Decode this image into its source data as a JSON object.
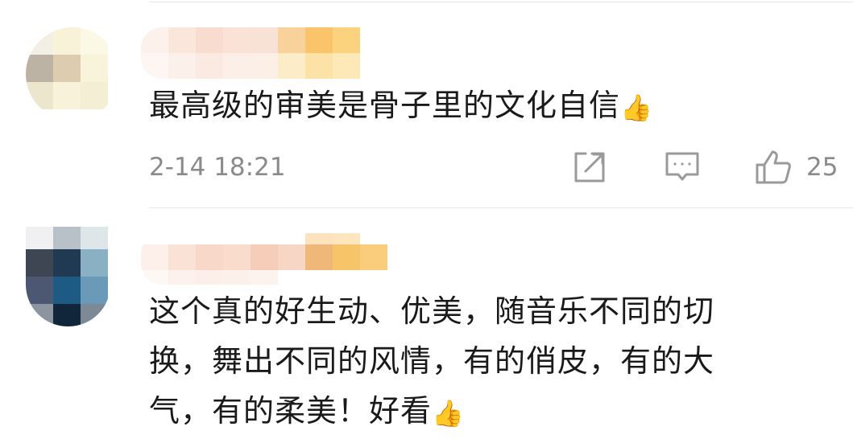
{
  "comments": [
    {
      "text": "最高级的审美是骨子里的文化自信",
      "emoji": "👍",
      "timestamp": "2-14 18:21",
      "likes": "25"
    },
    {
      "lines": [
        "这个真的好生动、优美，随音乐不同的切",
        "换，舞出不同的风情，有的俏皮，有的大",
        "气，有的柔美！好看"
      ],
      "emoji": "👍"
    }
  ],
  "icons": {
    "share": "share-icon",
    "comment": "comment-icon",
    "like": "thumbs-up-icon"
  },
  "colors": {
    "text": "#1a1a1a",
    "meta": "#8a8a8a",
    "icon": "#9a9a9a",
    "divider": "#e6e6e6"
  }
}
